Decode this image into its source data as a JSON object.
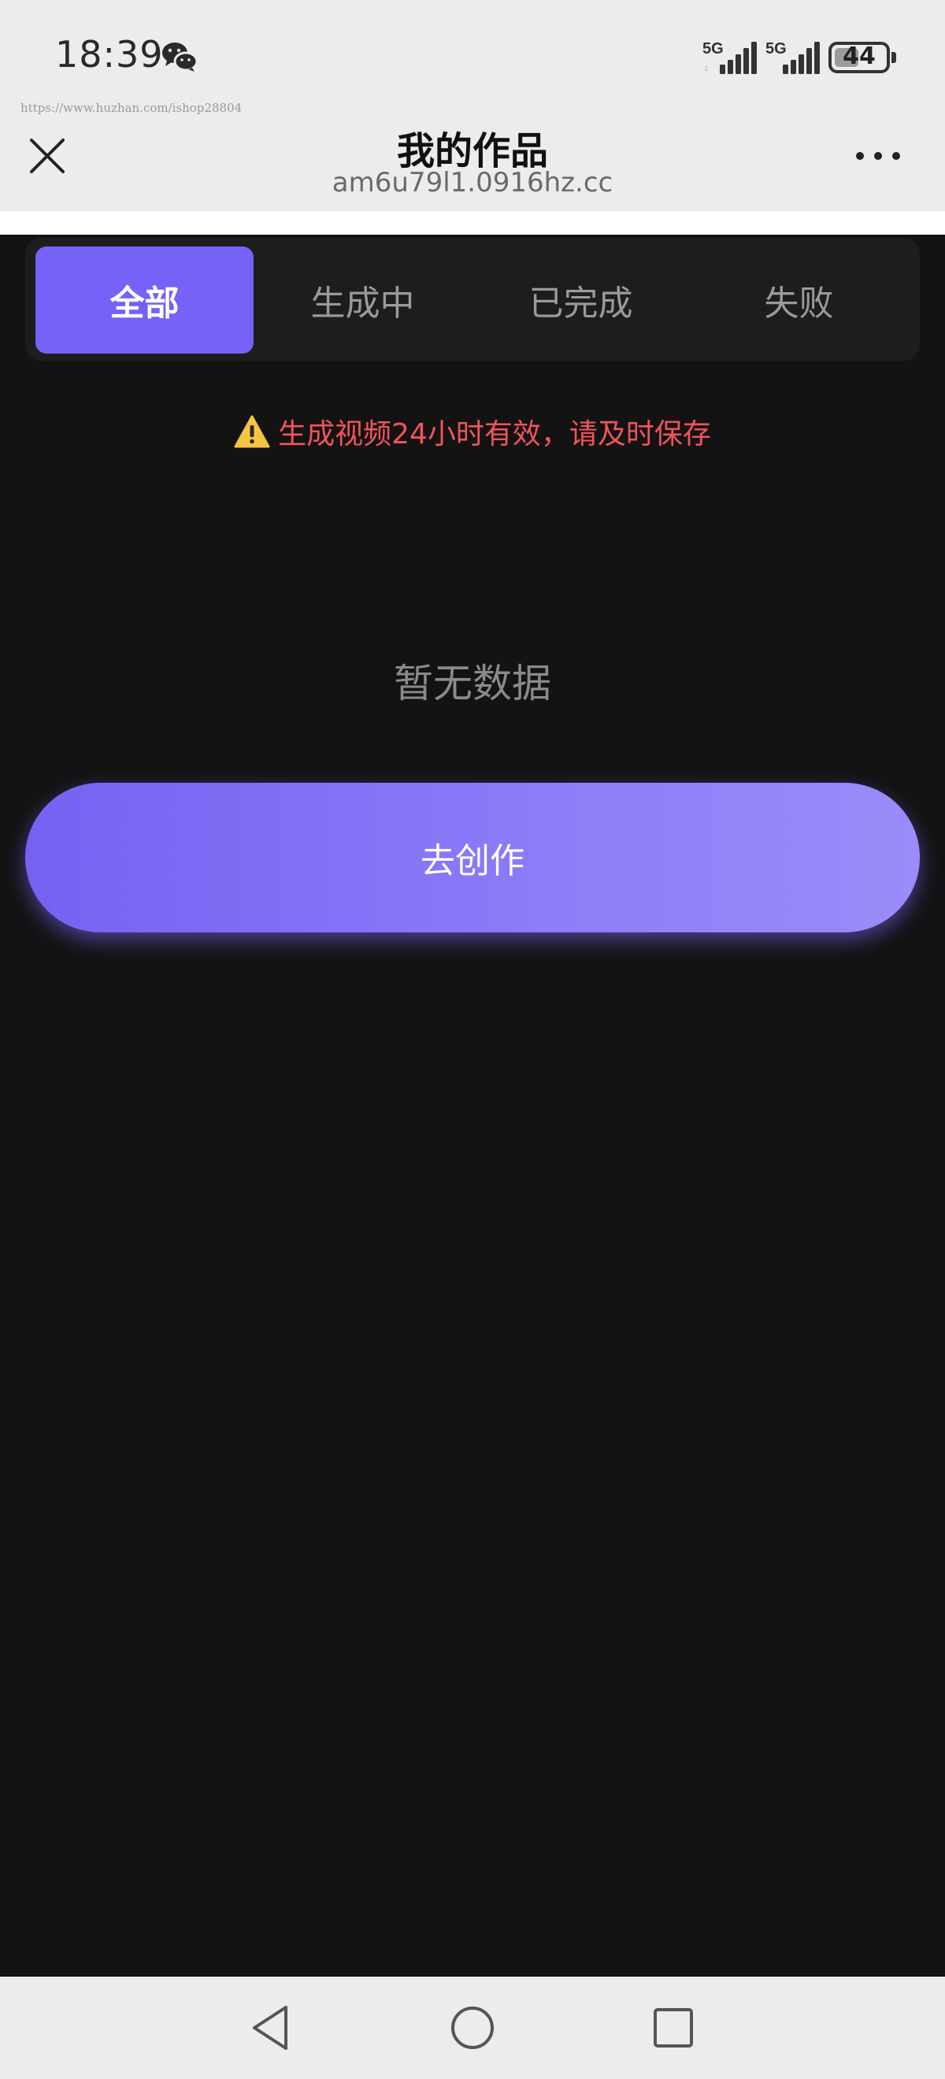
{
  "status_bar": {
    "time": "18:39",
    "network_1": "5G",
    "network_2": "5G",
    "battery": "44",
    "watermark": "https://www.huzhan.com/ishop28804"
  },
  "nav": {
    "title": "我的作品",
    "url": "am6u79l1.0916hz.cc"
  },
  "tabs": [
    {
      "label": "全部",
      "active": true
    },
    {
      "label": "生成中",
      "active": false
    },
    {
      "label": "已完成",
      "active": false
    },
    {
      "label": "失败",
      "active": false
    }
  ],
  "notice": {
    "icon": "warning-icon",
    "text": "生成视频24小时有效，请及时保存"
  },
  "empty_state": {
    "text": "暂无数据"
  },
  "create_button": {
    "label": "去创作"
  },
  "colors": {
    "accent": "#7562f6",
    "warning_text": "#f0545a",
    "background": "#131313"
  }
}
